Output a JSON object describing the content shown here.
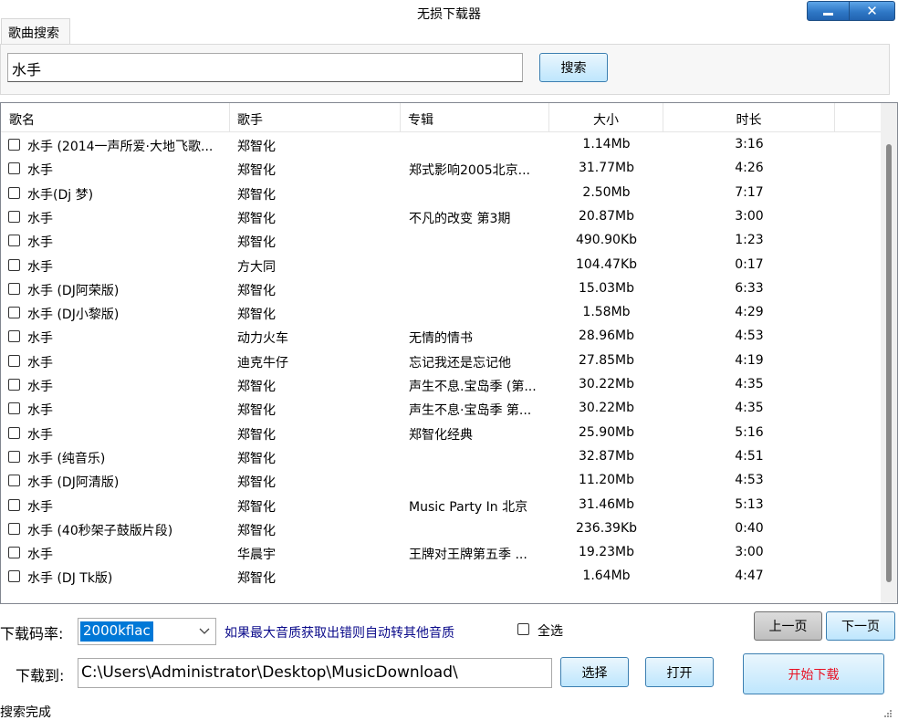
{
  "window": {
    "title": "无损下载器",
    "minimize_icon": "minimize-icon",
    "close_label": "✕"
  },
  "tabs": [
    {
      "label": "歌曲搜索"
    }
  ],
  "search": {
    "query": "水手",
    "button_label": "搜索"
  },
  "table": {
    "columns": [
      "歌名",
      "歌手",
      "专辑",
      "大小",
      "时长"
    ],
    "rows": [
      {
        "name": "水手 (2014一声所爱·大地飞歌...",
        "artist": "郑智化",
        "album": "",
        "size": "1.14Mb",
        "duration": "3:16"
      },
      {
        "name": "水手",
        "artist": "郑智化",
        "album": "郑式影响2005北京...",
        "size": "31.77Mb",
        "duration": "4:26"
      },
      {
        "name": "水手(Dj 梦)",
        "artist": "郑智化",
        "album": "",
        "size": "2.50Mb",
        "duration": "7:17"
      },
      {
        "name": "水手",
        "artist": "郑智化",
        "album": "不凡的改变 第3期",
        "size": "20.87Mb",
        "duration": "3:00"
      },
      {
        "name": "水手",
        "artist": "郑智化",
        "album": "",
        "size": "490.90Kb",
        "duration": "1:23"
      },
      {
        "name": "水手",
        "artist": "方大同",
        "album": "",
        "size": "104.47Kb",
        "duration": "0:17"
      },
      {
        "name": "水手 (DJ阿荣版)",
        "artist": "郑智化",
        "album": "",
        "size": "15.03Mb",
        "duration": "6:33"
      },
      {
        "name": "水手 (DJ小黎版)",
        "artist": "郑智化",
        "album": "",
        "size": "1.58Mb",
        "duration": "4:29"
      },
      {
        "name": "水手",
        "artist": "动力火车",
        "album": "无情的情书",
        "size": "28.96Mb",
        "duration": "4:53"
      },
      {
        "name": "水手",
        "artist": "迪克牛仔",
        "album": "忘记我还是忘记他",
        "size": "27.85Mb",
        "duration": "4:19"
      },
      {
        "name": "水手",
        "artist": "郑智化",
        "album": "声生不息.宝岛季 (第...",
        "size": "30.22Mb",
        "duration": "4:35"
      },
      {
        "name": "水手",
        "artist": "郑智化",
        "album": "声生不息·宝岛季 第...",
        "size": "30.22Mb",
        "duration": "4:35"
      },
      {
        "name": "水手",
        "artist": "郑智化",
        "album": "郑智化经典",
        "size": "25.90Mb",
        "duration": "5:16"
      },
      {
        "name": "水手 (纯音乐)",
        "artist": "郑智化",
        "album": "",
        "size": "32.87Mb",
        "duration": "4:51"
      },
      {
        "name": "水手 (DJ阿清版)",
        "artist": "郑智化",
        "album": "",
        "size": "11.20Mb",
        "duration": "4:53"
      },
      {
        "name": "水手",
        "artist": "郑智化",
        "album": "Music Party In 北京",
        "size": "31.46Mb",
        "duration": "5:13"
      },
      {
        "name": "水手 (40秒架子鼓版片段)",
        "artist": "郑智化",
        "album": "",
        "size": "236.39Kb",
        "duration": "0:40"
      },
      {
        "name": "水手",
        "artist": "华晨宇",
        "album": "王牌对王牌第五季 ...",
        "size": "19.23Mb",
        "duration": "3:00"
      },
      {
        "name": "水手 (DJ Tk版)",
        "artist": "郑智化",
        "album": "",
        "size": "1.64Mb",
        "duration": "4:47"
      }
    ]
  },
  "download": {
    "bitrate_label": "下载码率:",
    "bitrate_value": "2000kflac",
    "fallback_hint": "如果最大音质获取出错则自动转其他音质",
    "select_all_label": "全选",
    "prev_page": "上一页",
    "next_page": "下一页",
    "path_label": "下载到:",
    "path_value": "C:\\Users\\Administrator\\Desktop\\MusicDownload\\",
    "choose_label": "选择",
    "open_label": "打开",
    "start_label": "开始下载",
    "start_color": "#e81123"
  },
  "status": {
    "text": "搜索完成"
  }
}
